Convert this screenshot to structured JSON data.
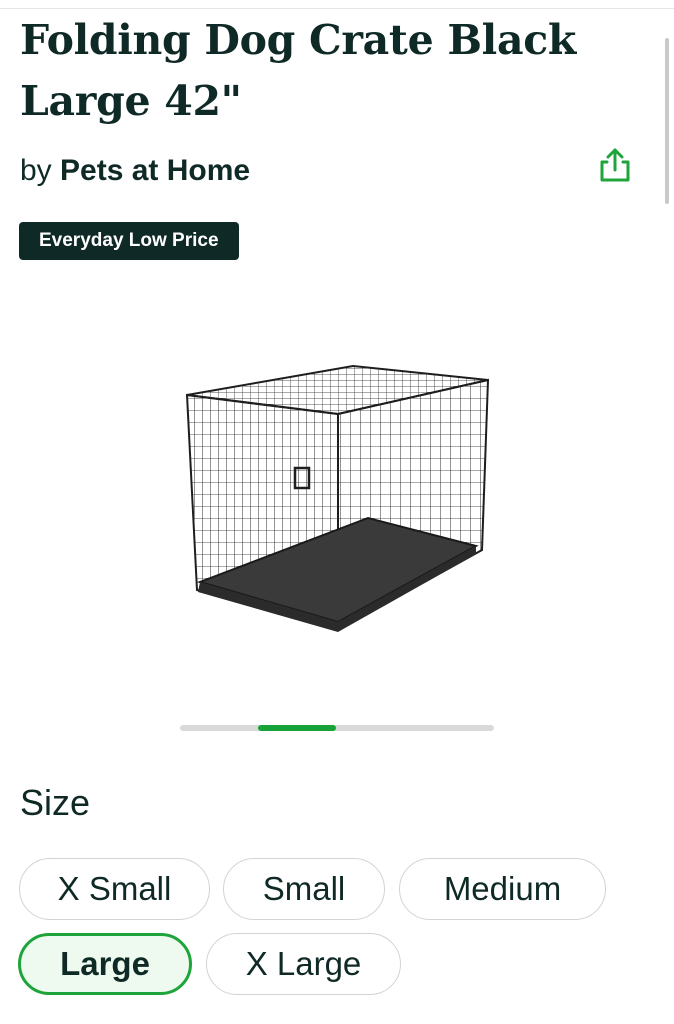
{
  "product": {
    "title": "Folding Dog Crate Black Large 42\"",
    "by_prefix": "by",
    "brand": "Pets at Home",
    "badge": "Everyday Low Price",
    "share_icon": "share-icon"
  },
  "carousel": {
    "active_index": 1,
    "total": 4
  },
  "size": {
    "label": "Size",
    "options": [
      "X Small",
      "Small",
      "Medium",
      "Large",
      "X Large"
    ],
    "selected": "Large"
  },
  "colors": {
    "primary_text": "#0f2a26",
    "accent_green": "#1ea43a",
    "badge_bg": "#0f2a26",
    "selected_bg": "#eefaef"
  }
}
